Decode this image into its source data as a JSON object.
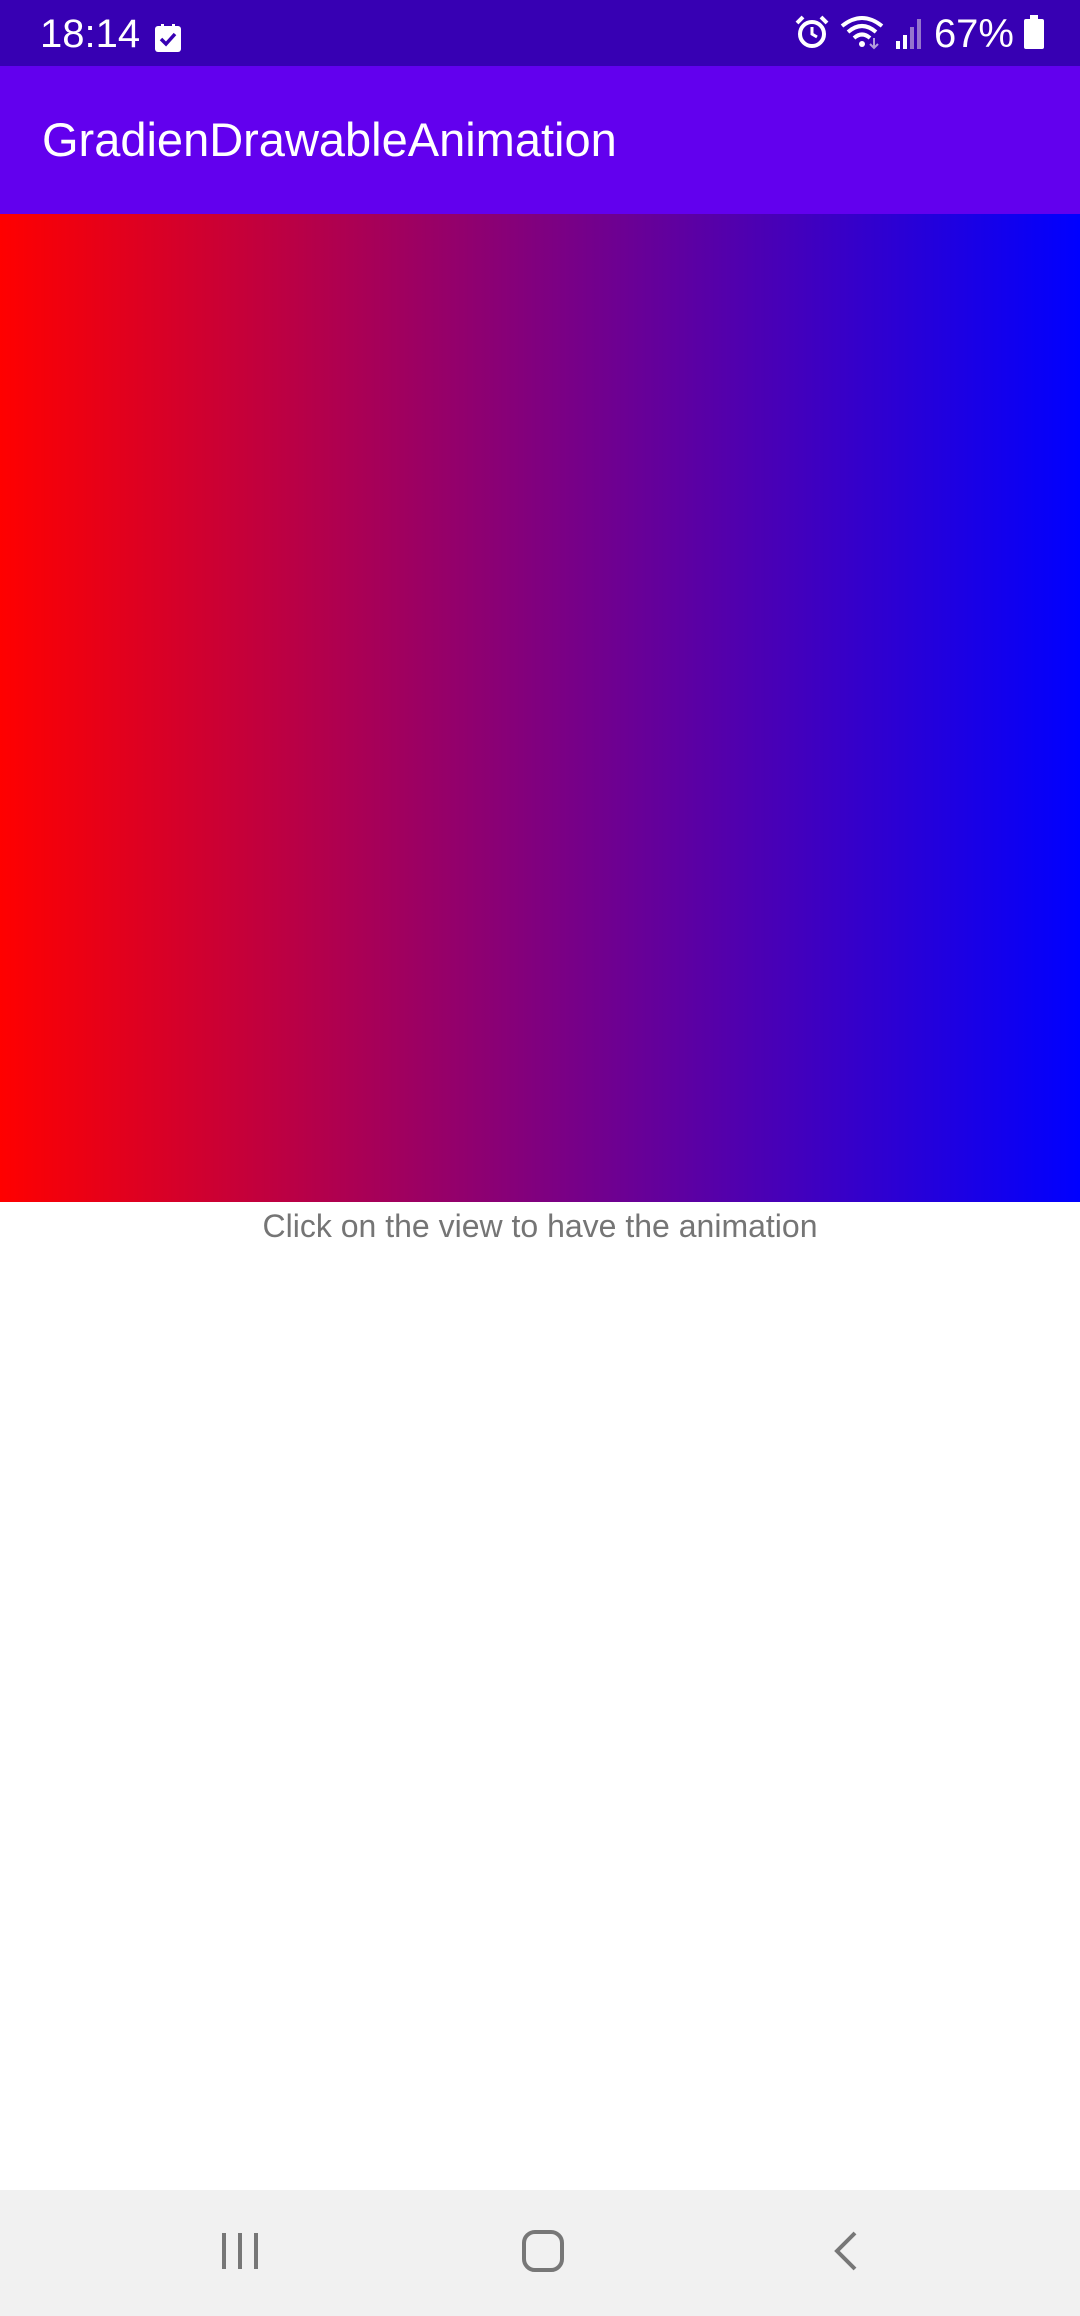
{
  "status_bar": {
    "time": "18:14",
    "battery_percent": "67%",
    "icons": [
      "checkbox-notification-icon",
      "alarm-icon",
      "wifi-icon",
      "signal-icon",
      "battery-icon"
    ]
  },
  "app_bar": {
    "title": "GradienDrawableAnimation"
  },
  "gradient_view": {
    "start_color": "#ff0000",
    "end_color": "#0000ff"
  },
  "hint": {
    "text": "Click on the view to have the animation"
  },
  "nav_bar": {
    "buttons": [
      "recents-icon",
      "home-icon",
      "back-icon"
    ]
  },
  "colors": {
    "status_bar": "#3700B3",
    "app_bar": "#6200EE",
    "hint_text": "#757575",
    "nav_bar": "#f1f1f1"
  }
}
